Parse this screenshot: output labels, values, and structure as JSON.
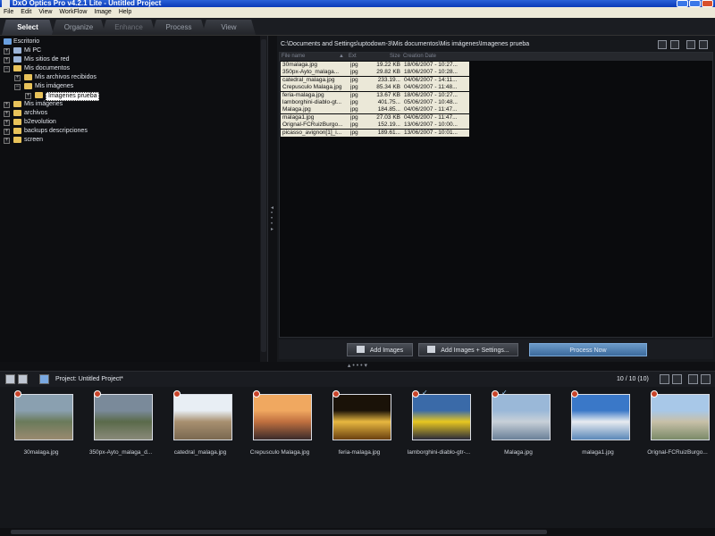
{
  "window": {
    "title": "DxO Optics Pro v4.2.1 Lite - Untitled Project"
  },
  "menu": [
    "File",
    "Edit",
    "View",
    "WorkFlow",
    "Image",
    "Help"
  ],
  "tabs": [
    "Select",
    "Organize",
    "Enhance",
    "Process",
    "View"
  ],
  "tree": [
    {
      "label": "Escritorio",
      "icon": "desktop-icon"
    },
    {
      "label": "Mi PC",
      "icon": "computer-icon"
    },
    {
      "label": "Mis sitios de red",
      "icon": "network-icon"
    },
    {
      "label": "Mis documentos",
      "icon": "folder-icon"
    },
    {
      "label": "Mis archivos recibidos",
      "icon": "folder-icon"
    },
    {
      "label": "Mis imágenes",
      "icon": "folder-icon"
    },
    {
      "label": "Imagenes prueba",
      "icon": "folder-icon",
      "selected": true
    },
    {
      "label": "Mis imágenes",
      "icon": "folder-icon"
    },
    {
      "label": "archivos",
      "icon": "folder-icon"
    },
    {
      "label": "b2evolution",
      "icon": "folder-icon"
    },
    {
      "label": "backups descripciones",
      "icon": "folder-icon"
    },
    {
      "label": "screen",
      "icon": "folder-icon"
    }
  ],
  "browser": {
    "path": "C:\\Documents and Settings\\uptodown-3\\Mis documentos\\Mis imágenes\\Imagenes prueba",
    "columns": [
      "File name",
      "Ext",
      "Size",
      "Creation Date"
    ],
    "files": [
      {
        "name": "30malaga.jpg",
        "ext": "jpg",
        "size": "19.22 KB",
        "date": "18/06/2007 - 10:27..."
      },
      {
        "name": "350px-Ayto_malaga...",
        "ext": "jpg",
        "size": "29.82 KB",
        "date": "18/06/2007 - 10:28..."
      },
      {
        "name": "catedral_malaga.jpg",
        "ext": "jpg",
        "size": "233.19...",
        "date": "04/06/2007 - 14:11..."
      },
      {
        "name": "Crepusculo Malaga.jpg",
        "ext": "jpg",
        "size": "85.34 KB",
        "date": "04/06/2007 - 11:48..."
      },
      {
        "name": "feria-malaga.jpg",
        "ext": "jpg",
        "size": "13.67 KB",
        "date": "18/06/2007 - 10:27..."
      },
      {
        "name": "lamborghini-diablo-gt...",
        "ext": "jpg",
        "size": "401.75...",
        "date": "05/06/2007 - 10:48..."
      },
      {
        "name": "Malaga.jpg",
        "ext": "jpg",
        "size": "184.85...",
        "date": "04/06/2007 - 11:47..."
      },
      {
        "name": "malaga1.jpg",
        "ext": "jpg",
        "size": "27.03 KB",
        "date": "04/06/2007 - 11:47..."
      },
      {
        "name": "Orignal-FCRuizBurgo...",
        "ext": "jpg",
        "size": "152.19...",
        "date": "13/06/2007 - 10:00..."
      },
      {
        "name": "picasso_avignon[1]_i...",
        "ext": "jpg",
        "size": "189.61...",
        "date": "13/06/2007 - 10:01..."
      }
    ],
    "buttons": {
      "add_images": "Add Images",
      "add_images_settings": "Add Images + Settings...",
      "process_now": "Process Now"
    }
  },
  "project": {
    "label": "Project:",
    "name": "Untitled Project*",
    "count": "10 / 10 (10)",
    "thumbnails": [
      {
        "label": "30malaga.jpg",
        "badge": true,
        "check": false,
        "colors": [
          "#8aa0b0",
          "#6a7a5a",
          "#9a8a70"
        ]
      },
      {
        "label": "350px-Ayto_malaga_d...",
        "badge": true,
        "check": false,
        "colors": [
          "#7a8a9a",
          "#5a6a4a",
          "#8a8a7a"
        ]
      },
      {
        "label": "catedral_malaga.jpg",
        "badge": true,
        "check": false,
        "colors": [
          "#e8eef4",
          "#a89070",
          "#7a6850"
        ]
      },
      {
        "label": "Crepusculo Malaga.jpg",
        "badge": true,
        "check": false,
        "colors": [
          "#f0a860",
          "#c07040",
          "#3a2a2a"
        ]
      },
      {
        "label": "feria-malaga.jpg",
        "badge": true,
        "check": false,
        "colors": [
          "#1a1208",
          "#e8b840",
          "#6a4010"
        ]
      },
      {
        "label": "lamborghini-diablo-gtr-...",
        "badge": true,
        "check": true,
        "colors": [
          "#3a6aa8",
          "#e8c820",
          "#2a2a3a"
        ]
      },
      {
        "label": "Malaga.jpg",
        "badge": true,
        "check": true,
        "colors": [
          "#9ab8d8",
          "#c8d0d8",
          "#6a8098"
        ]
      },
      {
        "label": "malaga1.jpg",
        "badge": true,
        "check": false,
        "colors": [
          "#3a78c8",
          "#e8ecf0",
          "#5a88b8"
        ]
      },
      {
        "label": "Orignal-FCRuizBurgo...",
        "badge": true,
        "check": false,
        "colors": [
          "#a8c8e8",
          "#c8c0a8",
          "#7a8a68"
        ]
      }
    ]
  }
}
